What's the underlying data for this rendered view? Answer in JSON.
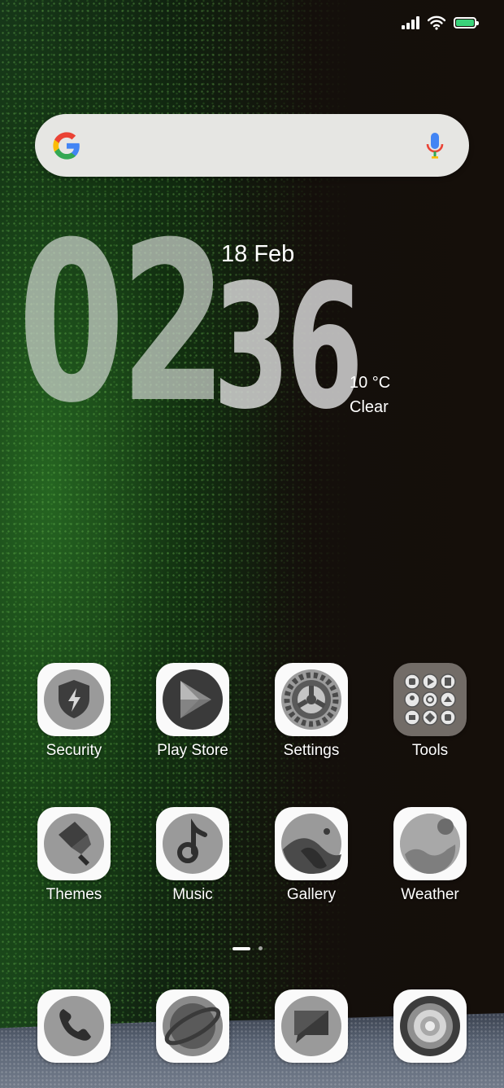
{
  "status_bar": {
    "battery_color": "#3ad27a",
    "icons": [
      "signal-icon",
      "wifi-icon",
      "battery-icon"
    ]
  },
  "search": {
    "logo": "google-logo",
    "voice": "microphone-icon"
  },
  "clock": {
    "hour": "02",
    "minute": "36",
    "date": "18 Feb",
    "temperature": "10 °C",
    "condition": "Clear"
  },
  "apps_row1": [
    {
      "label": "Security",
      "icon": "shield-lightning-icon"
    },
    {
      "label": "Play Store",
      "icon": "play-store-icon"
    },
    {
      "label": "Settings",
      "icon": "gear-icon"
    },
    {
      "label": "Tools",
      "icon": "folder-icon"
    }
  ],
  "apps_row2": [
    {
      "label": "Themes",
      "icon": "paint-brush-icon"
    },
    {
      "label": "Music",
      "icon": "music-note-icon"
    },
    {
      "label": "Gallery",
      "icon": "gallery-icon"
    },
    {
      "label": "Weather",
      "icon": "weather-icon"
    }
  ],
  "dock": [
    {
      "icon": "phone-icon"
    },
    {
      "icon": "browser-icon"
    },
    {
      "icon": "messages-icon"
    },
    {
      "icon": "camera-icon"
    }
  ],
  "page_indicator": {
    "pages": 2,
    "current": 1
  }
}
